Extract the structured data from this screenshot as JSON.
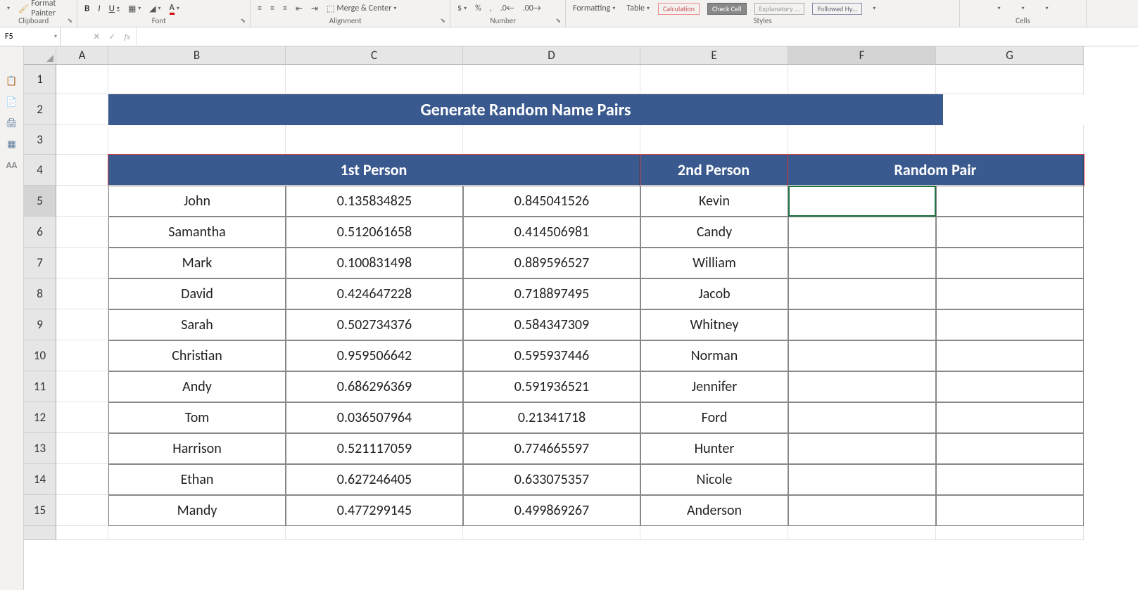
{
  "ribbon": {
    "clipboard": {
      "format_painter": "Format Painter",
      "label": "Clipboard"
    },
    "font": {
      "bold": "B",
      "italic": "I",
      "underline": "U",
      "label": "Font"
    },
    "alignment": {
      "merge": "Merge & Center",
      "label": "Alignment"
    },
    "number": {
      "label": "Number"
    },
    "styles": {
      "formatting": "Formatting",
      "table": "Table",
      "explanatory": "Explanatory ...",
      "label": "Styles"
    },
    "cells": {
      "label": "Cells"
    }
  },
  "formula_bar": {
    "name_box": "F5",
    "fx": "fx",
    "formula": ""
  },
  "columns": [
    "A",
    "B",
    "C",
    "D",
    "E",
    "F",
    "G"
  ],
  "row_numbers": [
    "1",
    "2",
    "3",
    "4",
    "5",
    "6",
    "7",
    "8",
    "9",
    "10",
    "11",
    "12",
    "13",
    "14",
    "15"
  ],
  "title": "Generate Random Name Pairs",
  "headers": {
    "b": "1st Person",
    "e": "2nd Person",
    "f": "Random Pair"
  },
  "data": [
    {
      "b": "John",
      "c": "0.135834825",
      "d": "0.845041526",
      "e": "Kevin"
    },
    {
      "b": "Samantha",
      "c": "0.512061658",
      "d": "0.414506981",
      "e": "Candy"
    },
    {
      "b": "Mark",
      "c": "0.100831498",
      "d": "0.889596527",
      "e": "William"
    },
    {
      "b": "David",
      "c": "0.424647228",
      "d": "0.718897495",
      "e": "Jacob"
    },
    {
      "b": "Sarah",
      "c": "0.502734376",
      "d": "0.584347309",
      "e": "Whitney"
    },
    {
      "b": "Christian",
      "c": "0.959506642",
      "d": "0.595937446",
      "e": "Norman"
    },
    {
      "b": "Andy",
      "c": "0.686296369",
      "d": "0.591936521",
      "e": "Jennifer"
    },
    {
      "b": "Tom",
      "c": "0.036507964",
      "d": "0.21341718",
      "e": "Ford"
    },
    {
      "b": "Harrison",
      "c": "0.521117059",
      "d": "0.774665597",
      "e": "Hunter"
    },
    {
      "b": "Ethan",
      "c": "0.627246405",
      "d": "0.633075357",
      "e": "Nicole"
    },
    {
      "b": "Mandy",
      "c": "0.477299145",
      "d": "0.499869267",
      "e": "Anderson"
    }
  ],
  "gutter_icons": [
    "clipboard",
    "paste-text",
    "paste-link",
    "table",
    "text-style"
  ]
}
